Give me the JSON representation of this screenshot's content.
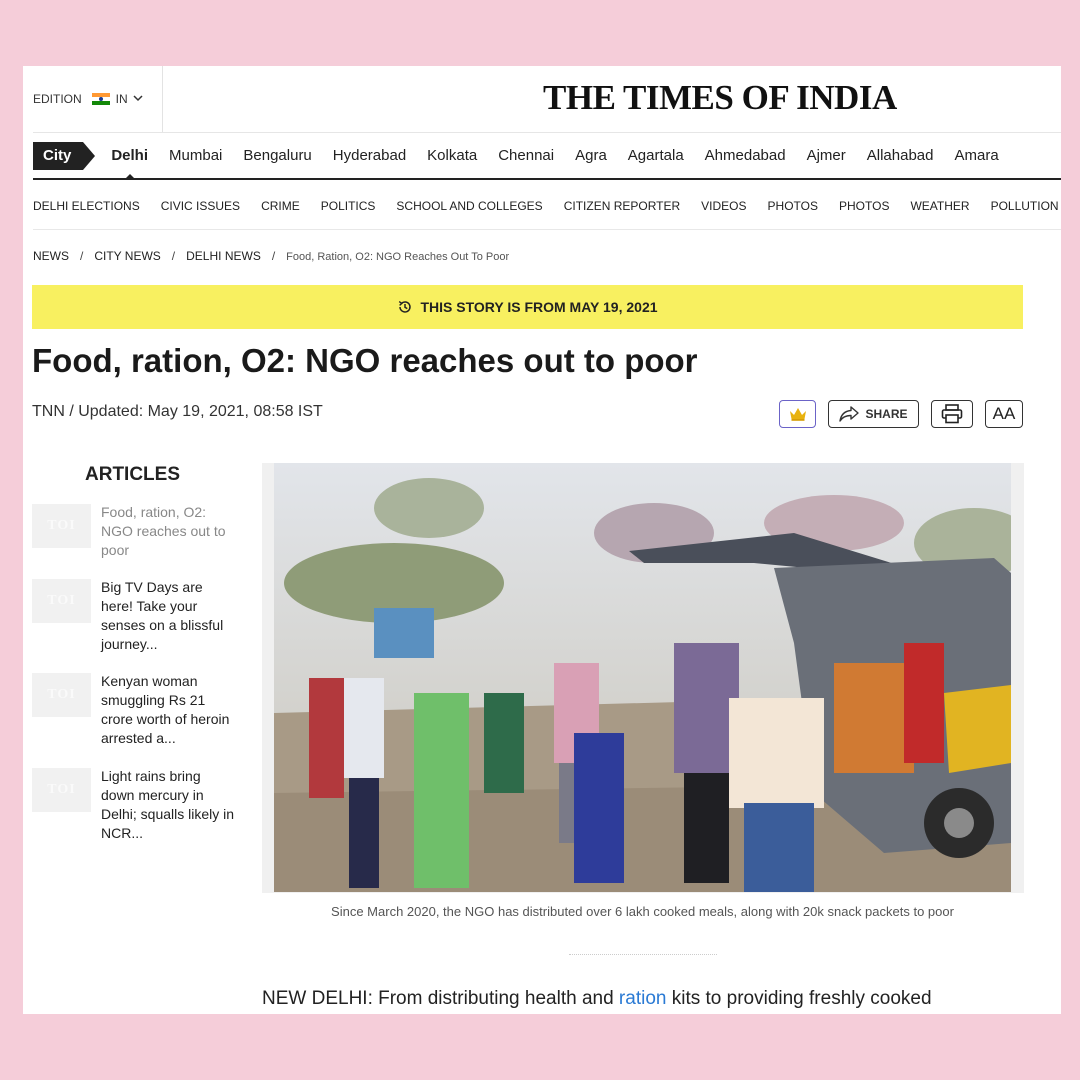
{
  "header": {
    "edition_label": "EDITION",
    "edition_value": "IN",
    "logo": "THE TIMES OF INDIA"
  },
  "city_nav": {
    "pill": "City",
    "items": [
      "Delhi",
      "Mumbai",
      "Bengaluru",
      "Hyderabad",
      "Kolkata",
      "Chennai",
      "Agra",
      "Agartala",
      "Ahmedabad",
      "Ajmer",
      "Allahabad",
      "Amara"
    ],
    "active": "Delhi"
  },
  "sub_nav": {
    "items": [
      "DELHI ELECTIONS",
      "CIVIC ISSUES",
      "CRIME",
      "POLITICS",
      "SCHOOL AND COLLEGES",
      "CITIZEN REPORTER",
      "VIDEOS",
      "PHOTOS",
      "PHOTOS",
      "WEATHER",
      "POLLUTION"
    ]
  },
  "breadcrumb": {
    "items": [
      "NEWS",
      "CITY NEWS",
      "DELHI NEWS"
    ],
    "current": "Food, Ration, O2: NGO Reaches Out To Poor"
  },
  "banner": {
    "text": "THIS STORY IS FROM MAY 19, 2021"
  },
  "article": {
    "headline": "Food, ration, O2: NGO reaches out to poor",
    "byline": "TNN / Updated: May 19, 2021, 08:58 IST",
    "share_label": "SHARE",
    "font_label": "AA",
    "caption": "Since March 2020, the NGO has distributed over 6 lakh cooked meals, along with 20k snack packets to poor",
    "body_before": "NEW DELHI: From distributing health and ",
    "body_link": "ration",
    "body_after": " kits to providing freshly cooked"
  },
  "sidebar": {
    "title": "ARTICLES",
    "thumb_label": "TOI",
    "items": [
      {
        "text": "Food, ration, O2: NGO reaches out to poor"
      },
      {
        "text": "Big TV Days are here! Take your senses on a blissful journey..."
      },
      {
        "text": "Kenyan woman smuggling Rs 21 crore worth of heroin arrested a..."
      },
      {
        "text": "Light rains bring down mercury in Delhi; squalls likely in NCR..."
      }
    ]
  },
  "colors": {
    "background": "#f5cdd9",
    "banner": "#f8f060",
    "link": "#2a7ad4",
    "crown_border": "#6b63c7",
    "crown": "#e8b20e"
  },
  "icons": [
    "chevron-down-icon",
    "india-flag-icon",
    "clock-history-icon",
    "crown-icon",
    "share-icon",
    "print-icon"
  ]
}
